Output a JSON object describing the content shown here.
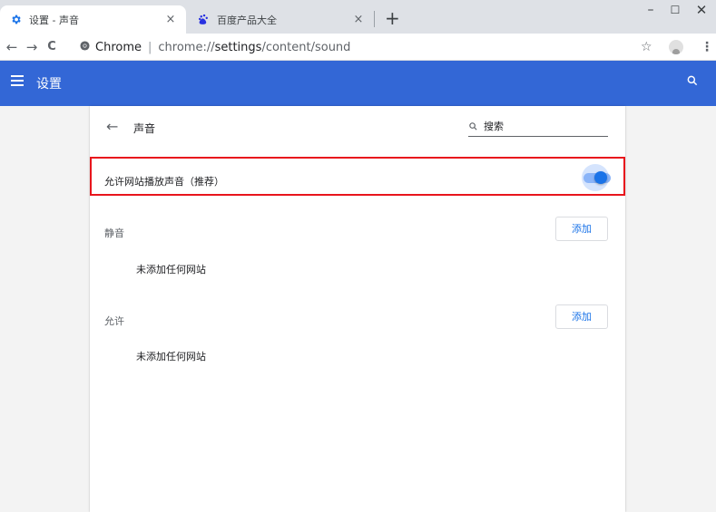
{
  "tabs": [
    {
      "title": "设置 - 声音",
      "active": true,
      "icon": "gear-icon"
    },
    {
      "title": "百度产品大全",
      "active": false,
      "icon": "baidu-paw-icon"
    }
  ],
  "tab_close_glyph": "×",
  "new_tab_glyph": "+",
  "window": {
    "minimize": "–",
    "maximize": "☐",
    "close": "✕"
  },
  "toolbar": {
    "back": "←",
    "forward": "→",
    "reload": "C",
    "origin": "Chrome",
    "url_prefix": "chrome://",
    "url_bold": "settings",
    "url_suffix": "/content/sound",
    "star": "☆",
    "menu": "⋮"
  },
  "appbar": {
    "title": "设置",
    "color": "#3367d6"
  },
  "subpage": {
    "back": "←",
    "title": "声音",
    "search_placeholder": "搜索"
  },
  "allow_sound": {
    "label": "允许网站播放声音（推荐）",
    "enabled": true
  },
  "sections": [
    {
      "label": "静音",
      "add_label": "添加",
      "empty_text": "未添加任何网站"
    },
    {
      "label": "允许",
      "add_label": "添加",
      "empty_text": "未添加任何网站"
    }
  ],
  "colors": {
    "accent": "#1a73e8",
    "highlight_border": "#e8151c"
  }
}
